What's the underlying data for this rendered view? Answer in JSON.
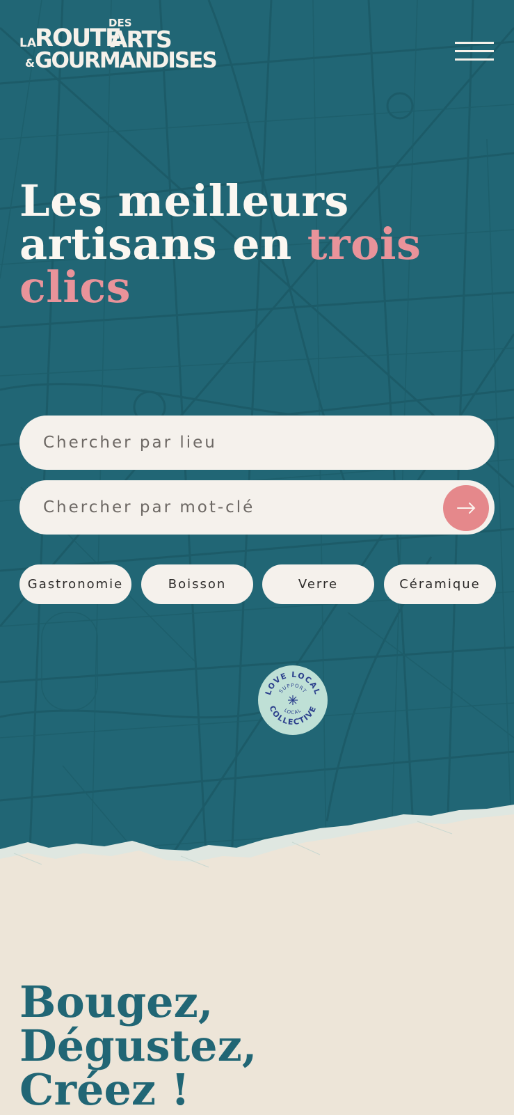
{
  "brand": {
    "logo_line1_prefix": "LA",
    "logo_route": "ROUTE",
    "logo_des": "DES",
    "logo_arts": "ARTS",
    "logo_amp": "&",
    "logo_gourmandises": "GOURMANDISES"
  },
  "header": {
    "menu_icon": "hamburger-menu-icon"
  },
  "hero": {
    "title_line1": "Les meilleurs",
    "title_line2_main": "artisans en ",
    "title_line2_accent": "trois",
    "title_line3_accent": "clics"
  },
  "search": {
    "location_placeholder": "Chercher par lieu",
    "keyword_placeholder": "Chercher par mot-clé",
    "submit_icon": "arrow-right-icon"
  },
  "categories": [
    {
      "label": "Gastronomie"
    },
    {
      "label": "Boisson"
    },
    {
      "label": "Verre"
    },
    {
      "label": "Céramique"
    }
  ],
  "badge": {
    "outer_top": "LOVE LOCAL",
    "outer_bottom": "COLLECTIVE",
    "inner_top": "SUPPORT",
    "inner_bottom": "LOCAL"
  },
  "section2": {
    "line1": "Bougez,",
    "line2": "Dégustez,",
    "line3": "Créez !"
  },
  "colors": {
    "hero_bg": "#216675",
    "accent_pink": "#e9939a",
    "cream": "#ede5d8",
    "field_bg": "#f5f1ec",
    "badge_bg": "#bfe0d6",
    "badge_text": "#2b3f8c"
  }
}
